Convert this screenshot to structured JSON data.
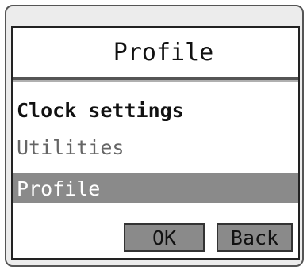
{
  "header": {
    "title": "Profile"
  },
  "menu": {
    "items": [
      {
        "label": "Clock settings",
        "state": "bold"
      },
      {
        "label": "Utilities",
        "state": "normal"
      },
      {
        "label": "Profile",
        "state": "selected"
      }
    ]
  },
  "buttons": {
    "ok_label": "OK",
    "back_label": "Back"
  },
  "colors": {
    "selection": "#8a8a8a",
    "frame": "#ececec",
    "screen": "#ffffff"
  }
}
